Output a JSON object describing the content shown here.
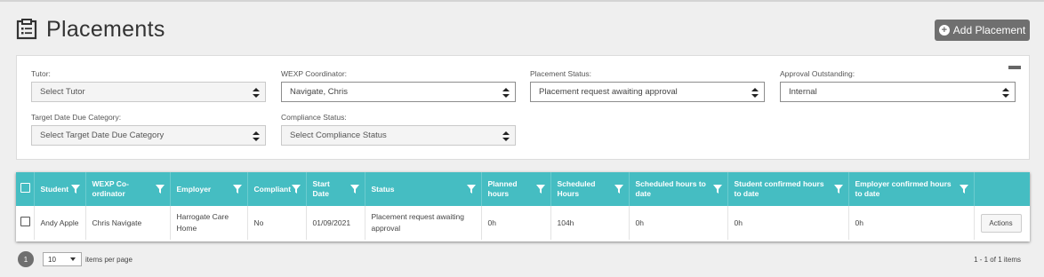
{
  "header": {
    "title": "Placements",
    "add_button": "Add Placement"
  },
  "filters": {
    "tutor": {
      "label": "Tutor:",
      "value": "Select Tutor"
    },
    "wexp": {
      "label": "WEXP Coordinator:",
      "value": "Navigate, Chris"
    },
    "status": {
      "label": "Placement Status:",
      "value": "Placement request awaiting approval"
    },
    "approval": {
      "label": "Approval Outstanding:",
      "value": "Internal"
    },
    "target": {
      "label": "Target Date Due Category:",
      "value": "Select Target Date Due Category"
    },
    "compliance": {
      "label": "Compliance Status:",
      "value": "Select Compliance Status"
    }
  },
  "table": {
    "headers": {
      "student": "Student",
      "wexp": "WEXP Co-ordinator",
      "employer": "Employer",
      "compliant": "Compliant",
      "start": "Start Date",
      "status": "Status",
      "planned": "Planned hours",
      "scheduled": "Scheduled Hours",
      "sched_to_date": "Scheduled hours to date",
      "student_conf": "Student confirmed hours to date",
      "employer_conf": "Employer confirmed hours to date"
    },
    "rows": [
      {
        "student": "Andy Apple",
        "wexp": "Chris Navigate",
        "employer": "Harrogate Care Home",
        "compliant": "No",
        "start": "01/09/2021",
        "status": "Placement request awaiting approval",
        "planned": "0h",
        "scheduled": "104h",
        "sched_to_date": "0h",
        "student_conf": "0h",
        "employer_conf": "0h",
        "actions": "Actions"
      }
    ]
  },
  "pager": {
    "current_page": "1",
    "page_size": "10",
    "per_page_label": "items per page",
    "info": "1 - 1 of 1 items"
  },
  "colors": {
    "header_teal": "#45bdc2",
    "button_grey": "#6f6f6f"
  },
  "icons": {
    "title": "clipboard-list-icon",
    "add": "plus-circle-icon",
    "filter": "funnel-icon",
    "collapse": "minimize-icon"
  }
}
